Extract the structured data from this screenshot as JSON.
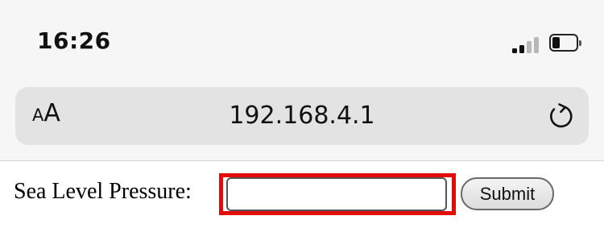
{
  "status_bar": {
    "time": "16:26",
    "signal_icon": "cellular-signal-icon",
    "signal_level": "2 of 4 bars",
    "battery_icon": "battery-icon",
    "battery_level": 0.2
  },
  "address_bar": {
    "text_size_small": "A",
    "text_size_large": "A",
    "url": "192.168.4.1",
    "reload_icon": "reload-icon"
  },
  "form": {
    "label": "Sea Level Pressure:",
    "input_value": "",
    "submit_label": "Submit"
  },
  "colors": {
    "highlight": "#e20a0a",
    "chrome_background": "#f6f6f6",
    "url_bar_background": "#e3e3e3"
  }
}
